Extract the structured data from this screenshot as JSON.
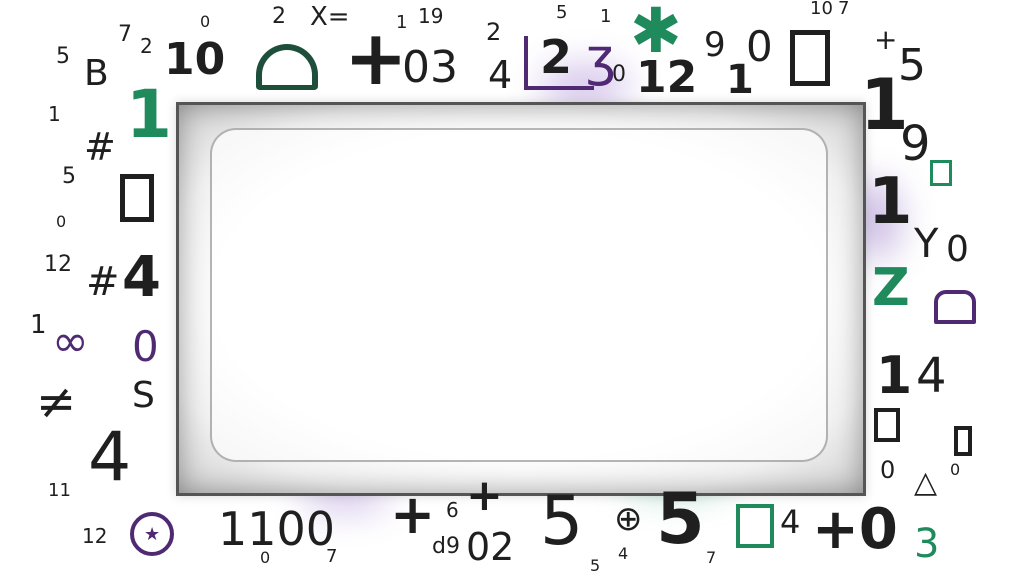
{
  "colors": {
    "ink": "#1f1f1f",
    "green": "#1f8a5c",
    "dark_green": "#1d4f3b",
    "purple": "#4f2a73",
    "frame": "#555555"
  },
  "frame": {
    "label": ""
  },
  "symbols": {
    "top": [
      "2",
      "X=",
      "0",
      "7",
      "2",
      "10",
      "+",
      "03",
      "4",
      "1",
      "19",
      "2",
      "5",
      "0",
      "12",
      "1",
      "1",
      "9",
      "0",
      "10",
      "7",
      "+",
      "5"
    ],
    "left": [
      "5",
      "B",
      "1",
      "1",
      "5",
      "0",
      "12",
      "4",
      "1",
      "0",
      "S",
      "4",
      "11"
    ],
    "right": [
      "1",
      "9",
      "1",
      "Y",
      "0",
      "Z",
      "1",
      "4",
      "0",
      "0",
      "3"
    ],
    "bottom": [
      "12",
      "1100",
      "+",
      "6",
      "+",
      "02",
      "5",
      "5",
      "4",
      "+0",
      "3",
      "7",
      "5",
      "d9",
      "0",
      "4",
      "7"
    ]
  }
}
